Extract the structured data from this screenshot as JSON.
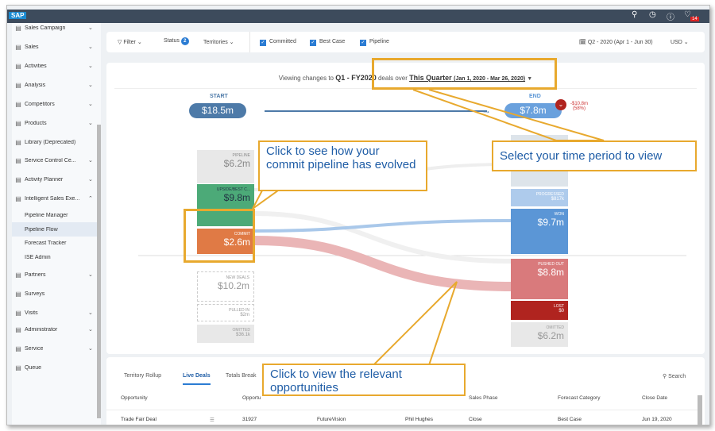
{
  "topbar": {
    "logo": "SAP",
    "icons": [
      "search-icon",
      "clock-icon",
      "help-icon",
      "bell-icon"
    ],
    "notifications": "14"
  },
  "sidebar": {
    "items": [
      {
        "label": "Sales Campaign",
        "icon": "campaign-icon",
        "chevron": "down"
      },
      {
        "label": "Sales",
        "icon": "sales-icon",
        "chevron": "down"
      },
      {
        "label": "Activities",
        "icon": "activities-icon",
        "chevron": "down"
      },
      {
        "label": "Analysis",
        "icon": "analysis-icon",
        "chevron": "down"
      },
      {
        "label": "Competitors",
        "icon": "competitors-icon",
        "chevron": "down"
      },
      {
        "label": "Products",
        "icon": "products-icon",
        "chevron": "down"
      },
      {
        "label": "Library (Deprecated)",
        "icon": "library-icon",
        "chevron": ""
      },
      {
        "label": "Service Control Ce...",
        "icon": "service-control-icon",
        "chevron": "down"
      },
      {
        "label": "Activity Planner",
        "icon": "planner-icon",
        "chevron": "down"
      },
      {
        "label": "Intelligent Sales Exe...",
        "icon": "ise-icon",
        "chevron": "up"
      },
      {
        "label": "Pipeline Manager",
        "sub": true
      },
      {
        "label": "Pipeline Flow",
        "sub": true,
        "selected": true
      },
      {
        "label": "Forecast Tracker",
        "sub": true
      },
      {
        "label": "ISE Admin",
        "sub": true
      },
      {
        "label": "Partners",
        "icon": "partners-icon",
        "chevron": "down"
      },
      {
        "label": "Surveys",
        "icon": "surveys-icon",
        "chevron": ""
      },
      {
        "label": "Visits",
        "icon": "visits-icon",
        "chevron": "down"
      },
      {
        "label": "Administrator",
        "icon": "admin-icon",
        "chevron": "down"
      },
      {
        "label": "Service",
        "icon": "service-icon",
        "chevron": "down"
      },
      {
        "label": "Queue",
        "icon": "queue-icon",
        "chevron": ""
      }
    ]
  },
  "filters": {
    "filter": "Filter",
    "status": "Status",
    "status_count": "2",
    "territories": "Territories",
    "committed": "Committed",
    "best_case": "Best Case",
    "pipeline": "Pipeline",
    "period": "Q2 - 2020 (Apr 1 - Jun 30)",
    "currency": "USD"
  },
  "chart": {
    "viewing_prefix": "Viewing changes to",
    "quarter": "Q1 - FY2020",
    "deals_over": "deals over",
    "period_main": "This Quarter",
    "period_range": "(Jan 1, 2020 - Mar 26, 2020)",
    "start_label": "START",
    "start_value": "$18.5m",
    "end_label": "END",
    "end_value": "$7.8m",
    "change": "-$10.8m",
    "change_pct": "(58%)",
    "left": [
      {
        "label": "PIPELINE",
        "value": "$6.2m"
      },
      {
        "label": "UPSIDE/BEST C...",
        "value": "$9.8m"
      },
      {
        "label": "COMMIT",
        "value": "$2.6m"
      },
      {
        "label": "NEW DEALS",
        "value": "$10.2m"
      },
      {
        "label": "PULLED IN",
        "value": "$2m"
      },
      {
        "label": "OMITTED",
        "value": "$36.1k"
      }
    ],
    "right": [
      {
        "label": "PROGRESSED",
        "value": "$817k"
      },
      {
        "label": "WON",
        "value": "$9.7m"
      },
      {
        "label": "PUSHED OUT",
        "value": "$8.8m"
      },
      {
        "label": "LOST",
        "value": "$0"
      },
      {
        "label": "OMITTED",
        "value": "$6.2m"
      }
    ],
    "colors": {
      "pipeline": "#e8e8e8",
      "upside": "#4caa78",
      "commit": "#e07a45",
      "won": "#5b96d6",
      "progressed": "#aecbec",
      "pushed": "#d97a7c",
      "lost": "#b0241f",
      "start": "#4d7aa8"
    }
  },
  "callouts": {
    "commit": "Click to see how your commit pipeline has evolved",
    "period": "Select your time period to view",
    "opps": "Click to view the relevant opportunities"
  },
  "table": {
    "tabs": [
      "Territory Rollup",
      "Live Deals",
      "Totals Break"
    ],
    "active_tab": "Live Deals",
    "search": "Search",
    "headers": [
      "Opportunity",
      "Opportu",
      "Sales Phase",
      "Forecast Category",
      "Close Date"
    ],
    "rows": [
      [
        "Trade Fair Deal",
        "31927",
        "FutureVision",
        "Phil Hughes",
        "Close",
        "Best Case",
        "Jun 19, 2020"
      ]
    ]
  }
}
